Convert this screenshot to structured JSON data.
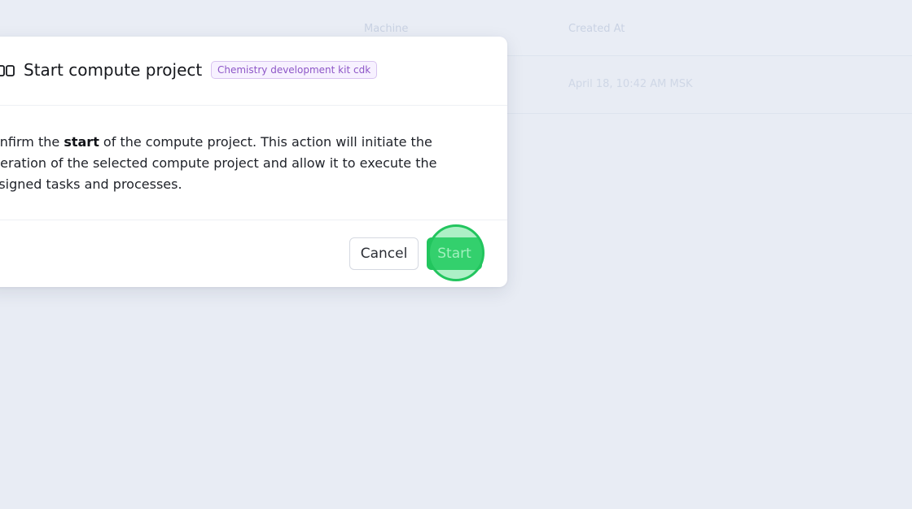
{
  "background_table": {
    "columns": [
      "Machine",
      "Created At"
    ],
    "row": {
      "created_at": "April 18, 10:42 AM MSK"
    }
  },
  "modal": {
    "icon": "compute-project-icon",
    "title": "Start compute project",
    "badge": "Chemistry development kit cdk",
    "body": {
      "line1_prefix": "onfirm the ",
      "line1_bold": "start",
      "line1_suffix": " of the compute project. This action will initiate the",
      "line2": "peration of the selected compute project and allow it to execute the",
      "line3": "ssigned tasks and processes."
    },
    "buttons": {
      "cancel": "Cancel",
      "start": "Start"
    }
  },
  "colors": {
    "backdrop": "#e8ecf4",
    "primary_green": "#22c55e",
    "badge_purple": "#8d56c7",
    "badge_bg": "#f7f1ff"
  }
}
